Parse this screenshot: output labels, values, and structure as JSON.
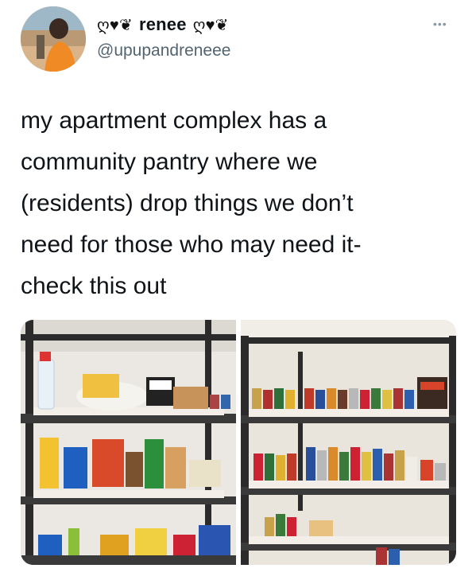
{
  "tweet": {
    "display_name": "renee",
    "name_left_ornament": "ღ♥❦",
    "name_right_ornament": "ღ♥❦",
    "handle": "@upupandreneee",
    "more_label": "•••",
    "text": "my apartment complex has a\ncommunity pantry where we\n(residents) drop things we don’t\nneed for those who may need it-\ncheck this out"
  },
  "media": {
    "images": [
      {
        "icon": "pantry-shelves-photo-left"
      },
      {
        "icon": "pantry-shelves-photo-right"
      }
    ]
  },
  "colors": {
    "text": "#0f1419",
    "secondary_text": "#536471",
    "background": "#ffffff",
    "shelf_metal": "#2b2b2b",
    "wall": "#e9e6e1"
  }
}
